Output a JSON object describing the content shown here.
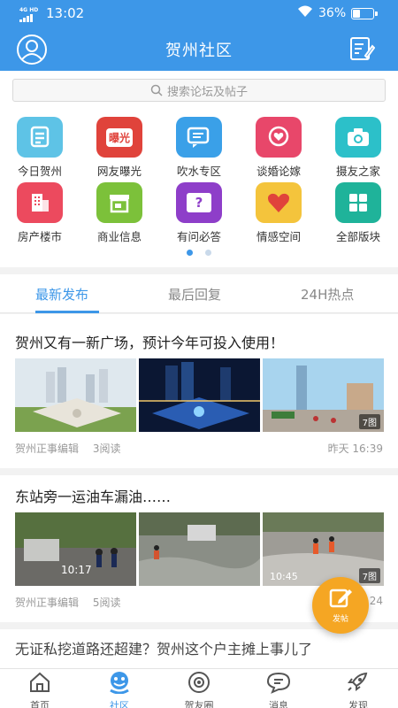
{
  "status_bar": {
    "network": "4G HD",
    "time": "13:02",
    "battery": "36%",
    "battery_level": 0.36
  },
  "header": {
    "title": "贺州社区"
  },
  "search": {
    "placeholder": "搜索论坛及帖子"
  },
  "categories": [
    {
      "label": "今日贺州",
      "icon": "document-icon",
      "color": "#5ec3e6"
    },
    {
      "label": "网友曝光",
      "icon": "expose-icon",
      "color": "#e0433b"
    },
    {
      "label": "吹水专区",
      "icon": "chat-icon",
      "color": "#3aa0e8"
    },
    {
      "label": "谈婚论嫁",
      "icon": "heart-bubble-icon",
      "color": "#e8476a"
    },
    {
      "label": "摄友之家",
      "icon": "camera-icon",
      "color": "#2cc0c9"
    },
    {
      "label": "房产楼市",
      "icon": "building-icon",
      "color": "#ec4a5e"
    },
    {
      "label": "商业信息",
      "icon": "shop-icon",
      "color": "#7cc13a"
    },
    {
      "label": "有问必答",
      "icon": "question-icon",
      "color": "#8e3ec9"
    },
    {
      "label": "情感空间",
      "icon": "heart-icon",
      "color": "#f4c43c"
    },
    {
      "label": "全部版块",
      "icon": "grid-icon",
      "color": "#1fb39a"
    }
  ],
  "expose_badge": "曝光",
  "question_badge": "?",
  "pager": {
    "pages": 2,
    "current": 0
  },
  "tabs": [
    {
      "label": "最新发布",
      "active": true
    },
    {
      "label": "最后回复",
      "active": false
    },
    {
      "label": "24H热点",
      "active": false
    }
  ],
  "posts": [
    {
      "title": "贺州又有一新广场，预计今年可投入使用！",
      "author": "贺州正事编辑",
      "reads": "3阅读",
      "time": "昨天 16:39",
      "image_count": "7图"
    },
    {
      "title": "东站旁一运油车漏油……",
      "author": "贺州正事编辑",
      "reads": "5阅读",
      "time": "24",
      "image_count": "7图",
      "photo_time_1": "10:17",
      "photo_time_2": "10:45"
    },
    {
      "title": "无证私挖道路还超建？贺州这个户主摊上事儿了"
    }
  ],
  "fab": {
    "label": "发帖"
  },
  "bottom_nav": [
    {
      "label": "首页",
      "icon": "home-icon",
      "active": false
    },
    {
      "label": "社区",
      "icon": "community-icon",
      "active": true
    },
    {
      "label": "贺友圈",
      "icon": "circle-icon",
      "active": false
    },
    {
      "label": "消息",
      "icon": "message-icon",
      "active": false
    },
    {
      "label": "发现",
      "icon": "rocket-icon",
      "active": false
    }
  ],
  "colors": {
    "primary": "#3d97e8",
    "fab": "#f5a623"
  }
}
